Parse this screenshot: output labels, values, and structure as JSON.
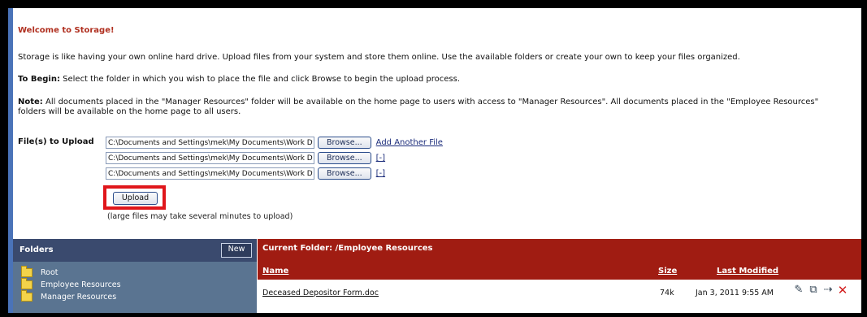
{
  "page": {
    "welcome_title": "Welcome to Storage!",
    "intro": "Storage is like having your own online hard drive. Upload files from your system and store them online. Use the available folders or create your own to keep your files organized.",
    "begin_label": "To Begin:",
    "begin_text": " Select the folder in which you wish to place the file and click Browse to begin the upload process.",
    "note_label": "Note:",
    "note_text": " All documents placed in the \"Manager Resources\" folder will be available on the home page to users with access to \"Manager Resources\". All documents placed in the \"Employee Resources\" folders will be available on the home page to all users."
  },
  "upload": {
    "label": "File(s) to Upload",
    "files": [
      "C:\\Documents and Settings\\mek\\My Documents\\Work D",
      "C:\\Documents and Settings\\mek\\My Documents\\Work D",
      "C:\\Documents and Settings\\mek\\My Documents\\Work D"
    ],
    "browse_label": "Browse...",
    "add_another": "Add Another File",
    "remove_label": "[-]",
    "upload_button": "Upload",
    "note": "(large files may take several minutes to upload)"
  },
  "folders": {
    "title": "Folders",
    "new_button": "New",
    "items": [
      "Root",
      "Employee Resources",
      "Manager Resources"
    ]
  },
  "current_folder": {
    "title": "Current Folder: /Employee Resources",
    "columns": {
      "name": "Name",
      "size": "Size",
      "modified": "Last Modified"
    },
    "rows": [
      {
        "name": "Deceased Depositor Form.doc",
        "size": "74k",
        "modified": "Jan 3, 2011 9:55 AM"
      }
    ]
  }
}
